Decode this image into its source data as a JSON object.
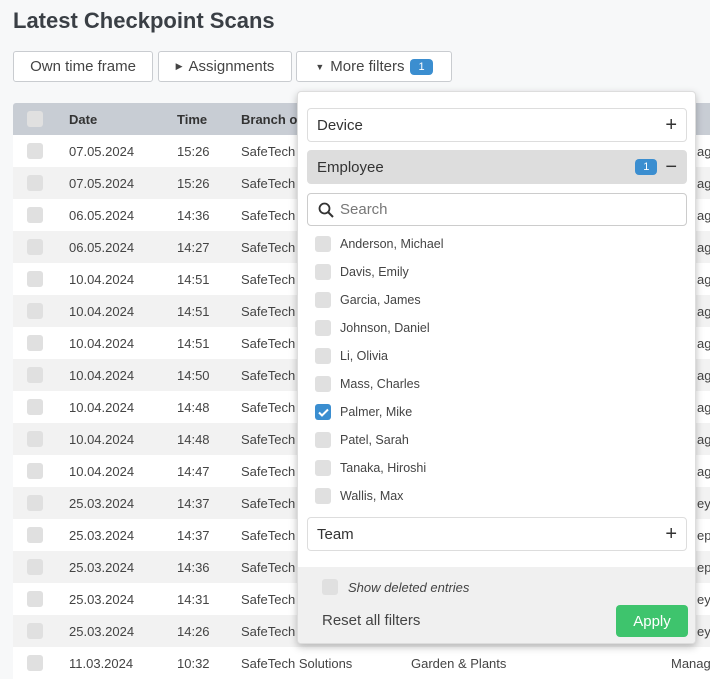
{
  "title": "Latest Checkpoint Scans",
  "filters": {
    "own_time_frame": "Own time frame",
    "assignments": "Assignments",
    "more_filters": "More filters",
    "more_filters_count": "1"
  },
  "table": {
    "headers": {
      "date": "Date",
      "time": "Time",
      "branch": "Branch of"
    },
    "rows": [
      {
        "date": "07.05.2024",
        "time": "15:26",
        "branch": "SafeTech",
        "right": "ag"
      },
      {
        "date": "07.05.2024",
        "time": "15:26",
        "branch": "SafeTech",
        "right": "ag"
      },
      {
        "date": "06.05.2024",
        "time": "14:36",
        "branch": "SafeTech",
        "right": "ag"
      },
      {
        "date": "06.05.2024",
        "time": "14:27",
        "branch": "SafeTech",
        "right": "ag"
      },
      {
        "date": "10.04.2024",
        "time": "14:51",
        "branch": "SafeTech",
        "right": "ag"
      },
      {
        "date": "10.04.2024",
        "time": "14:51",
        "branch": "SafeTech",
        "right": "ag"
      },
      {
        "date": "10.04.2024",
        "time": "14:51",
        "branch": "SafeTech",
        "right": "ag"
      },
      {
        "date": "10.04.2024",
        "time": "14:50",
        "branch": "SafeTech",
        "right": "ag"
      },
      {
        "date": "10.04.2024",
        "time": "14:48",
        "branch": "SafeTech",
        "right": "ag"
      },
      {
        "date": "10.04.2024",
        "time": "14:48",
        "branch": "SafeTech",
        "right": "ag"
      },
      {
        "date": "10.04.2024",
        "time": "14:47",
        "branch": "SafeTech",
        "right": "ag"
      },
      {
        "date": "25.03.2024",
        "time": "14:37",
        "branch": "SafeTech",
        "right": "ey"
      },
      {
        "date": "25.03.2024",
        "time": "14:37",
        "branch": "SafeTech",
        "right": "epa"
      },
      {
        "date": "25.03.2024",
        "time": "14:36",
        "branch": "SafeTech",
        "right": "epa"
      },
      {
        "date": "25.03.2024",
        "time": "14:31",
        "branch": "SafeTech",
        "right": "ey"
      },
      {
        "date": "25.03.2024",
        "time": "14:26",
        "branch": "SafeTech",
        "right": "ey"
      },
      {
        "date": "11.03.2024",
        "time": "10:32",
        "branch": "SafeTech Solutions",
        "category": "Garden & Plants",
        "right": "Manag"
      }
    ]
  },
  "panel": {
    "device": "Device",
    "employee": "Employee",
    "employee_count": "1",
    "team": "Team",
    "search_placeholder": "Search",
    "employees": [
      {
        "name": "Anderson, Michael",
        "checked": false
      },
      {
        "name": "Davis, Emily",
        "checked": false
      },
      {
        "name": "Garcia, James",
        "checked": false
      },
      {
        "name": "Johnson, Daniel",
        "checked": false
      },
      {
        "name": "Li, Olivia",
        "checked": false
      },
      {
        "name": "Mass, Charles",
        "checked": false
      },
      {
        "name": "Palmer, Mike",
        "checked": true
      },
      {
        "name": "Patel, Sarah",
        "checked": false
      },
      {
        "name": "Tanaka, Hiroshi",
        "checked": false
      },
      {
        "name": "Wallis, Max",
        "checked": false
      }
    ],
    "show_deleted": "Show deleted entries",
    "reset": "Reset all filters",
    "apply": "Apply"
  },
  "colors": {
    "accent": "#3b8ed0",
    "apply": "#3ec46d",
    "header": "#c8cdd4"
  }
}
